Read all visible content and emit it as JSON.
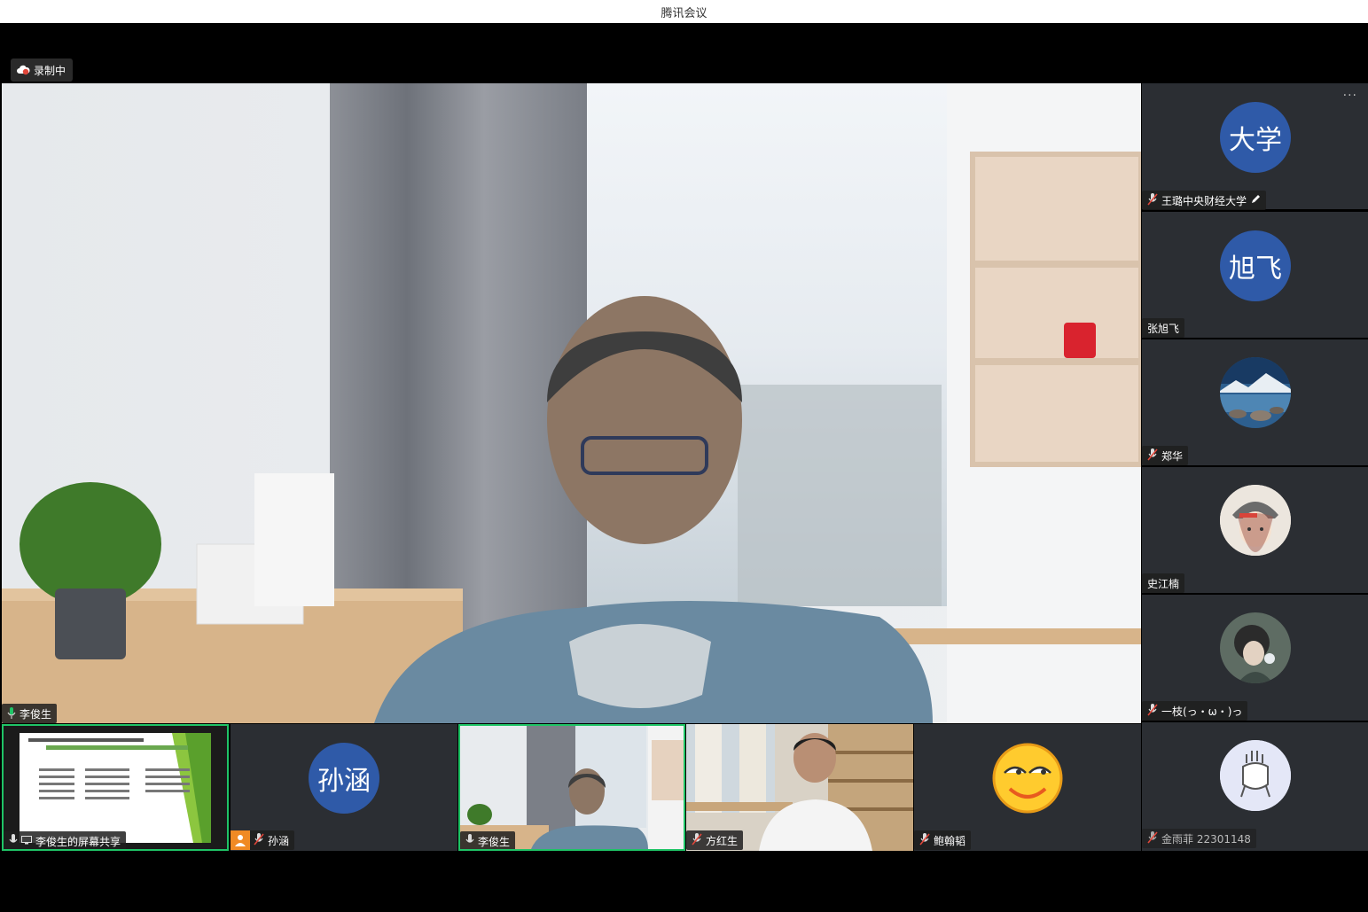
{
  "window": {
    "title": "腾讯会议"
  },
  "recording": {
    "label": "录制中"
  },
  "main_speaker": {
    "name": "李俊生"
  },
  "sidebar": {
    "more_label": "···",
    "participants": [
      {
        "name": "王璐中央财经大学",
        "avatar_text": "大学",
        "avatar": "text",
        "mic": "muted",
        "edit_icon": true
      },
      {
        "name": "张旭飞",
        "avatar_text": "旭飞",
        "avatar": "text",
        "mic": "none"
      },
      {
        "name": "郑华",
        "avatar": "lake-photo",
        "mic": "muted"
      },
      {
        "name": "史江楠",
        "avatar": "cartoon-girl",
        "mic": "none"
      },
      {
        "name": "一枝(っ・ω・)っ",
        "avatar": "portrait-photo",
        "mic": "muted"
      },
      {
        "name": "金雨菲 22301148",
        "avatar": "doodle",
        "mic": "muted"
      }
    ]
  },
  "bottom_row": [
    {
      "name": "李俊生的屏幕共享",
      "type": "screen-share",
      "active": true
    },
    {
      "name": "孙涵",
      "avatar_text": "孙涵",
      "type": "avatar"
    },
    {
      "name": "李俊生",
      "type": "video",
      "active": true
    },
    {
      "name": "方红生",
      "type": "video"
    },
    {
      "name": "鲍翰韬",
      "type": "emoji"
    }
  ],
  "colors": {
    "accent_green": "#1fc466",
    "avatar_blue": "#2f5aa8",
    "muted_red": "#e0463a",
    "tile_bg": "#2b2e33"
  }
}
